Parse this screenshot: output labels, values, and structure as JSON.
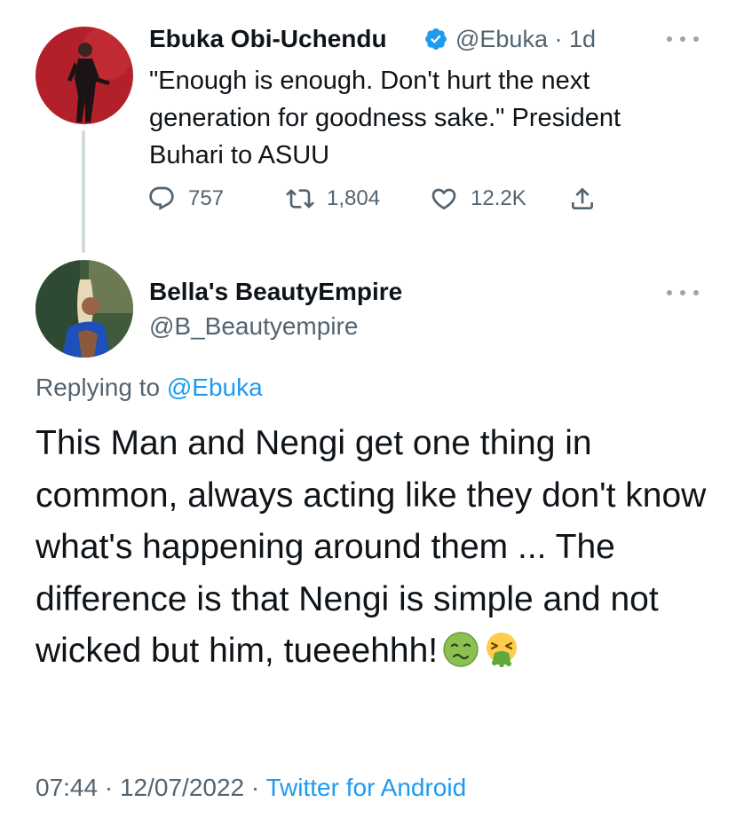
{
  "parent_tweet": {
    "author_name": "Ebuka Obi-Uchendu",
    "verified_icon": "verified-badge-icon",
    "handle": "@Ebuka",
    "separator": "·",
    "time_ago": "1d",
    "text": "\"Enough is enough. Don't hurt the next generation for goodness sake.\" President Buhari to ASUU",
    "reply_count": "757",
    "retweet_count": "1,804",
    "like_count": "12.2K"
  },
  "reply_tweet": {
    "author_name": "Bella's BeautyEmpire",
    "handle": "@B_Beautyempire",
    "replying_prefix": "Replying to",
    "replying_to": "@Ebuka",
    "text": "This Man and Nengi get one thing in common, always acting like they don't know what's happening around them ... The difference is that Nengi is simple and not wicked but him, tueeehhh!",
    "emojis": [
      "nauseated-face-emoji",
      "face-vomiting-emoji"
    ],
    "time": "07:44",
    "separator": "·",
    "date": "12/07/2022",
    "source": "Twitter for Android"
  },
  "colors": {
    "text_primary": "#0f1419",
    "text_secondary": "#536471",
    "link": "#1d9bf0",
    "verified": "#1d9bf0",
    "thread_line": "#cfd9de"
  }
}
